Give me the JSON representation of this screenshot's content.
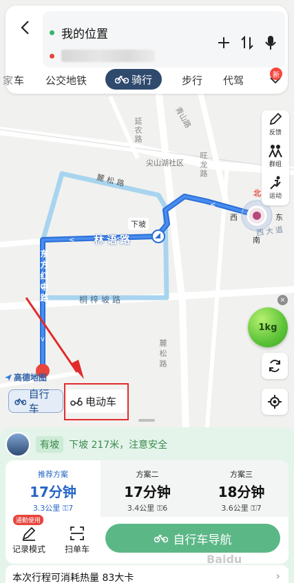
{
  "search": {
    "origin": "我的位置",
    "destination": ""
  },
  "mode_tabs": {
    "partial": "车",
    "partial_prefix": "家",
    "transit": "公交地铁",
    "cycling": "骑行",
    "walking": "步行",
    "rideshare": "代驾",
    "new_badge": "新"
  },
  "right_tools": {
    "feedback": "反馈",
    "group": "群组",
    "sport": "运动"
  },
  "map_labels": {
    "qingshan_road": "青山路",
    "yanong_road": "延农路",
    "jianshan_lake": "尖山湖社区",
    "wanglong_road": "旺龙路",
    "lisong_road": "麓松路",
    "lisong_road_south": "麓松路",
    "linyu_road": "林语路",
    "tongzipo_road": "桐梓坡路",
    "dongfanghong_road": "东方红中路",
    "downhill": "下坡",
    "compass_n": "北",
    "compass_s": "南",
    "compass_w": "西",
    "compass_e": "东",
    "avenue": "西大道"
  },
  "calorie_bubble": "1kg",
  "logo": "高德地图",
  "vehicle": {
    "bike": "自行车",
    "ebike": "电动车"
  },
  "slope": {
    "tag": "有坡",
    "desc": "下坡 217米，注意安全"
  },
  "plans": [
    {
      "name": "推荐方案",
      "time": "17分钟",
      "dist": "3.3公里",
      "lights": "7"
    },
    {
      "name": "方案二",
      "time": "17分钟",
      "dist": "3.4公里",
      "lights": "6"
    },
    {
      "name": "方案三",
      "time": "18分钟",
      "dist": "3.6公里",
      "lights": "7"
    }
  ],
  "actions": {
    "commute_badge": "通勤使用",
    "record": "记录模式",
    "scan": "扫单车",
    "navigate": "自行车导航"
  },
  "calories": "本次行程可消耗热量 83大卡",
  "watermark": "Baidu"
}
